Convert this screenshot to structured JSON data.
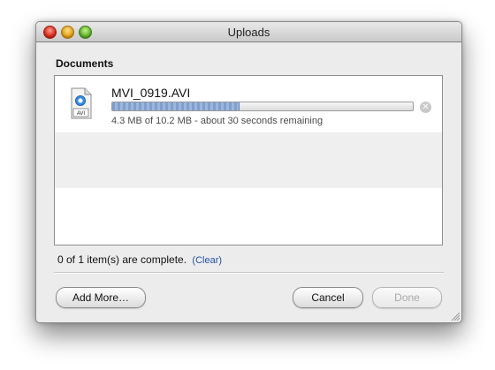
{
  "window": {
    "title": "Uploads"
  },
  "section": {
    "heading": "Documents"
  },
  "uploads": [
    {
      "file_name": "MVI_0919.AVI",
      "icon_label": "AVI",
      "icon": "avi-file-icon",
      "progress": 0.42,
      "status": "4.3 MB of 10.2 MB - about 30 seconds remaining"
    }
  ],
  "summary": {
    "text": "0 of 1 item(s) are complete.",
    "clear_label": "(Clear)"
  },
  "buttons": {
    "add_more": "Add More…",
    "cancel": "Cancel",
    "done": "Done"
  },
  "colors": {
    "accent_link": "#2351a5",
    "progress_fill": "#8eabd6"
  }
}
